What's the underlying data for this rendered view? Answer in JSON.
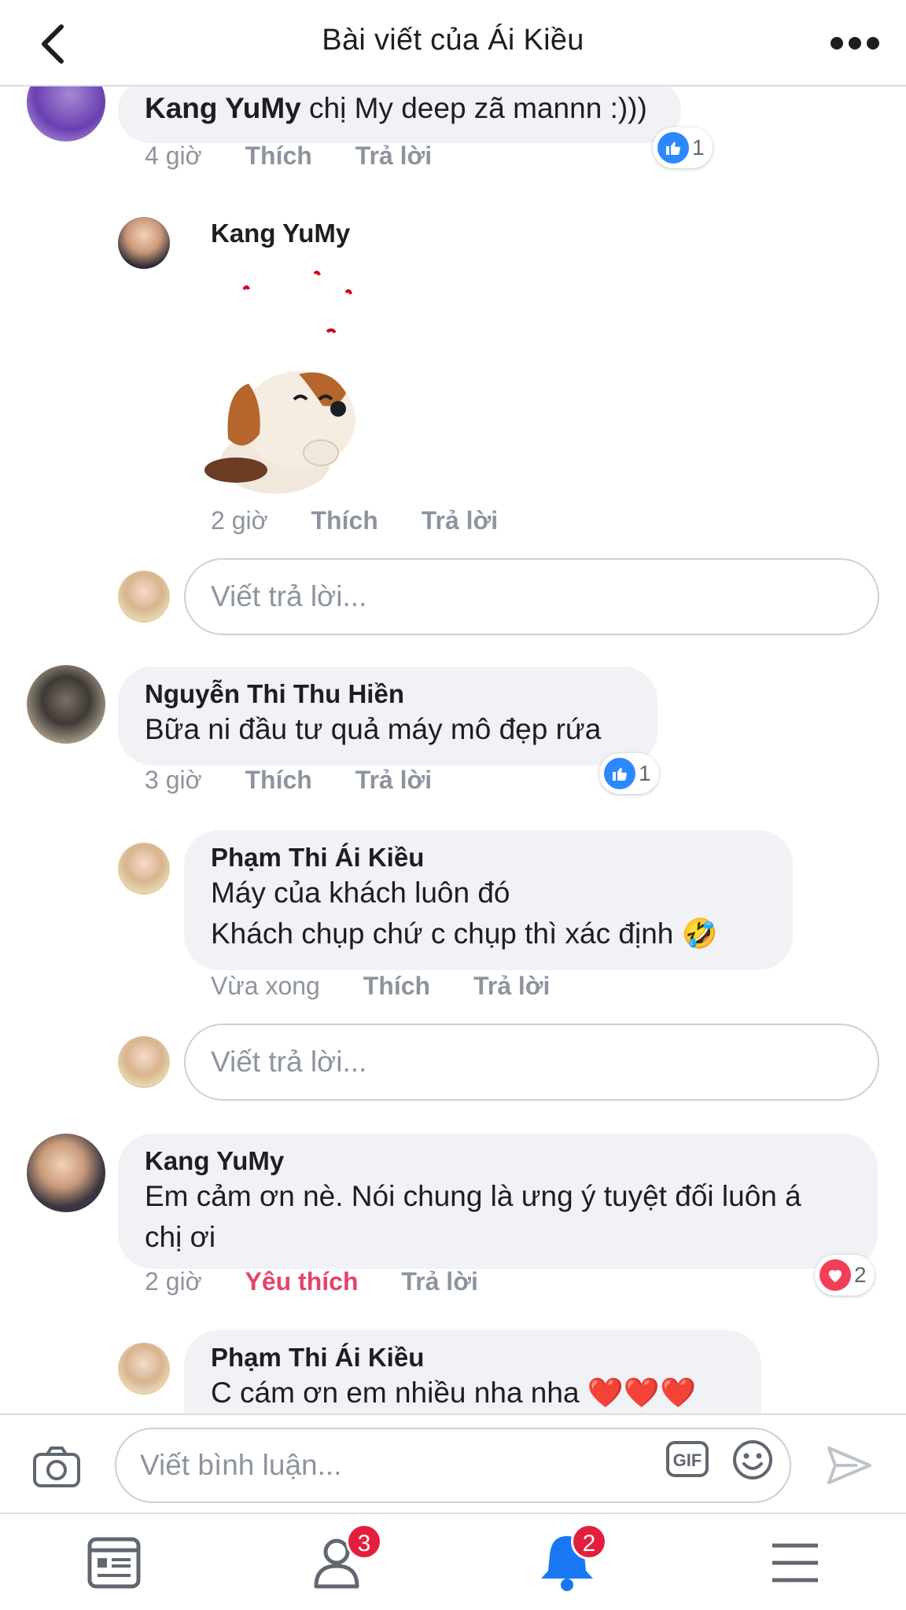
{
  "header": {
    "title": "Bài viết của Ái Kiều"
  },
  "comments": [
    {
      "author": "Kang YuMy",
      "text": "chị My deep zã mannn :)))",
      "time": "4 giờ",
      "like_label": "Thích",
      "reply_label": "Trả lời",
      "reaction_count": "1"
    },
    {
      "author": "Kang YuMy",
      "sticker": "dog-sticker",
      "time": "2 giờ",
      "like_label": "Thích",
      "reply_label": "Trả lời"
    },
    {
      "author": "Nguyễn Thi Thu Hiền",
      "text": "Bữa ni đầu tư quả máy mô đẹp rứa",
      "time": "3 giờ",
      "like_label": "Thích",
      "reply_label": "Trả lời",
      "reaction_count": "1"
    },
    {
      "author": "Phạm Thi Ái Kiều",
      "text_line1": "Máy của khách luôn đó",
      "text_line2": "Khách chụp chứ c chụp thì xác định 🤣",
      "time": "Vừa xong",
      "like_label": "Thích",
      "reply_label": "Trả lời"
    },
    {
      "author": "Kang YuMy",
      "text_line1": "Em cảm ơn nè. Nói chung là ưng ý tuyệt đối luôn á",
      "text_line2": "chị ơi",
      "time": "2 giờ",
      "like_label": "Yêu thích",
      "reply_label": "Trả lời",
      "reaction_count": "2"
    },
    {
      "author": "Phạm Thi Ái Kiều",
      "text": "C cám ơn em nhiều nha nha ❤️❤️❤️"
    }
  ],
  "reply_placeholder": "Viết trả lời...",
  "composer": {
    "placeholder": "Viết bình luận..."
  },
  "bottom_nav": {
    "friends_badge": "3",
    "notifications_badge": "2"
  },
  "colors": {
    "accent": "#1877f2",
    "love": "#e5436a",
    "bubble": "#f0f2f5",
    "meta": "#8d949e"
  }
}
